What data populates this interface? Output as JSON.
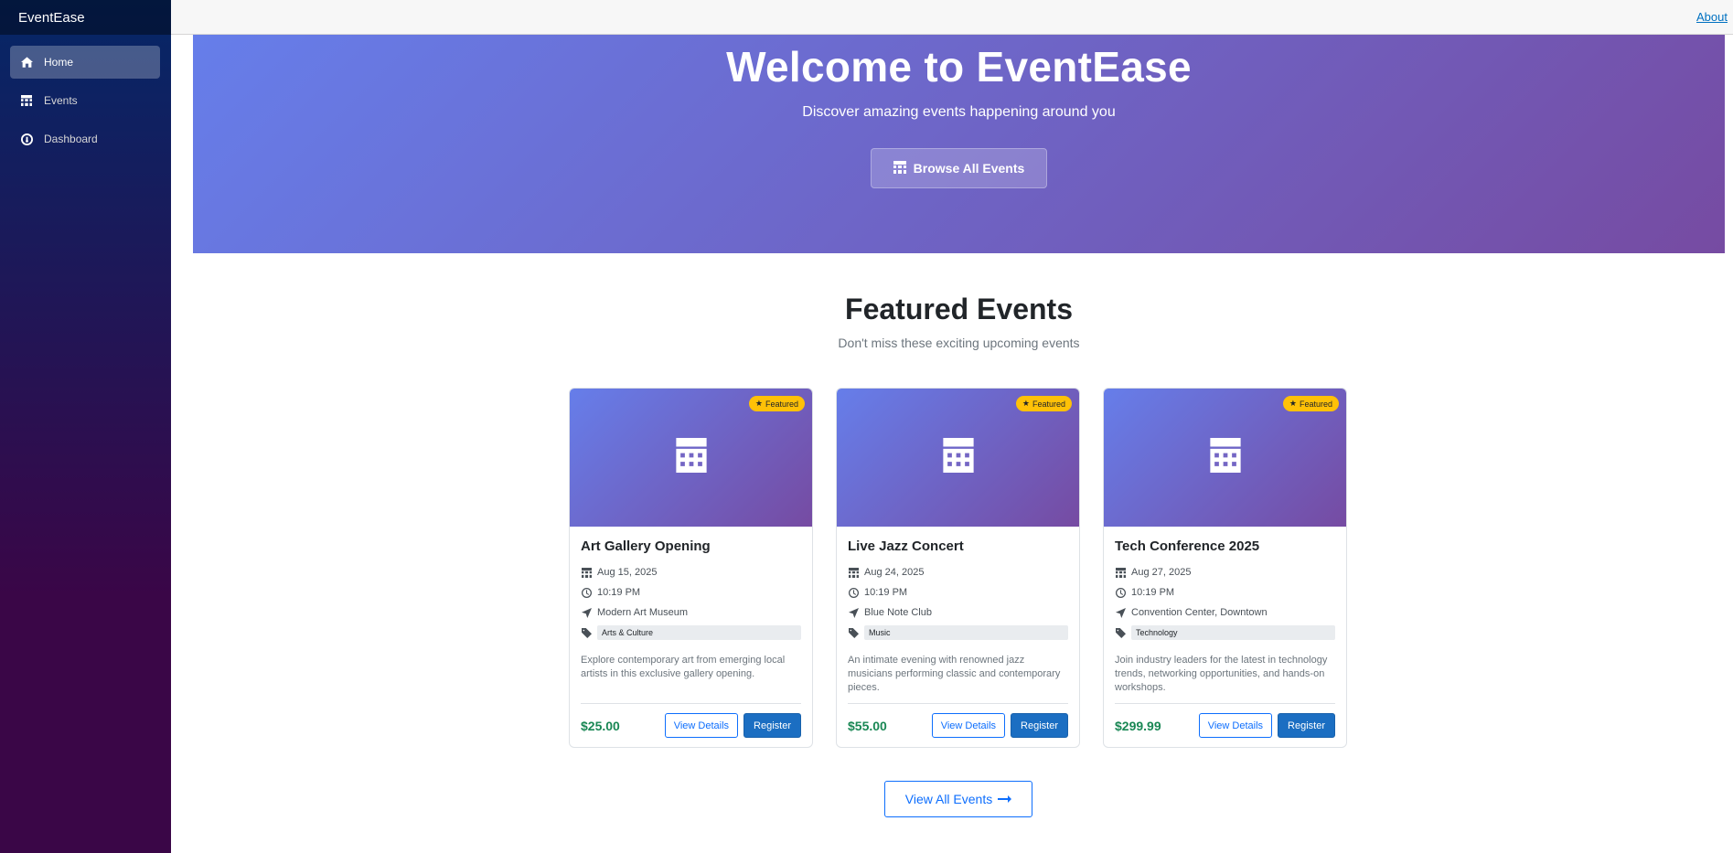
{
  "app": {
    "brand": "EventEase"
  },
  "sidebar": {
    "items": [
      {
        "label": "Home",
        "icon": "home-icon",
        "active": true
      },
      {
        "label": "Events",
        "icon": "calendar-icon",
        "active": false
      },
      {
        "label": "Dashboard",
        "icon": "dashboard-icon",
        "active": false
      }
    ]
  },
  "topbar": {
    "about_label": "About"
  },
  "hero": {
    "title": "Welcome to EventEase",
    "subtitle": "Discover amazing events happening around you",
    "browse_label": "Browse All Events"
  },
  "featured": {
    "title": "Featured Events",
    "subtitle": "Don't miss these exciting upcoming events",
    "badge_label": "Featured",
    "cards": [
      {
        "title": "Art Gallery Opening",
        "date": "Aug 15, 2025",
        "time": "10:19 PM",
        "location": "Modern Art Museum",
        "category": "Arts & Culture",
        "description": "Explore contemporary art from emerging local artists in this exclusive gallery opening.",
        "price": "$25.00"
      },
      {
        "title": "Live Jazz Concert",
        "date": "Aug 24, 2025",
        "time": "10:19 PM",
        "location": "Blue Note Club",
        "category": "Music",
        "description": "An intimate evening with renowned jazz musicians performing classic and contemporary pieces.",
        "price": "$55.00"
      },
      {
        "title": "Tech Conference 2025",
        "date": "Aug 27, 2025",
        "time": "10:19 PM",
        "location": "Convention Center, Downtown",
        "category": "Technology",
        "description": "Join industry leaders for the latest in technology trends, networking opportunities, and hands-on workshops.",
        "price": "$299.99"
      }
    ],
    "view_details_label": "View Details",
    "register_label": "Register",
    "view_all_label": "View All Events"
  },
  "colors": {
    "hero_gradient_start": "#667eea",
    "hero_gradient_end": "#764ba2",
    "badge": "#ffc107",
    "price": "#198754",
    "primary": "#1b6ec2"
  }
}
